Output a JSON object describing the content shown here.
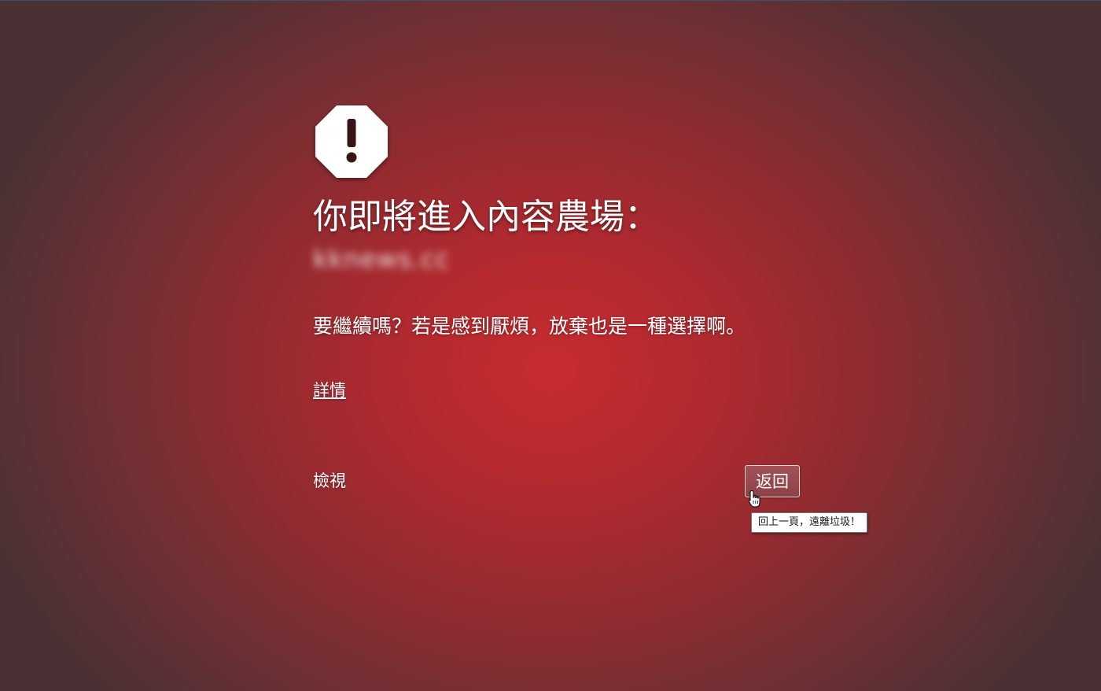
{
  "page": {
    "title": "你即將進入內容農場：",
    "domain": "kknews.cc",
    "message": "要繼續嗎？若是感到厭煩，放棄也是一種選擇啊。",
    "details_link": "詳情",
    "view_link": "檢視",
    "back_button": "返回",
    "back_tooltip": "回上一頁，遠離垃圾！",
    "icon": "octagon-exclamation-warning-icon"
  },
  "colors": {
    "background_center": "#c72c2f",
    "background_edge": "#4a3133",
    "text": "#ffffff"
  }
}
